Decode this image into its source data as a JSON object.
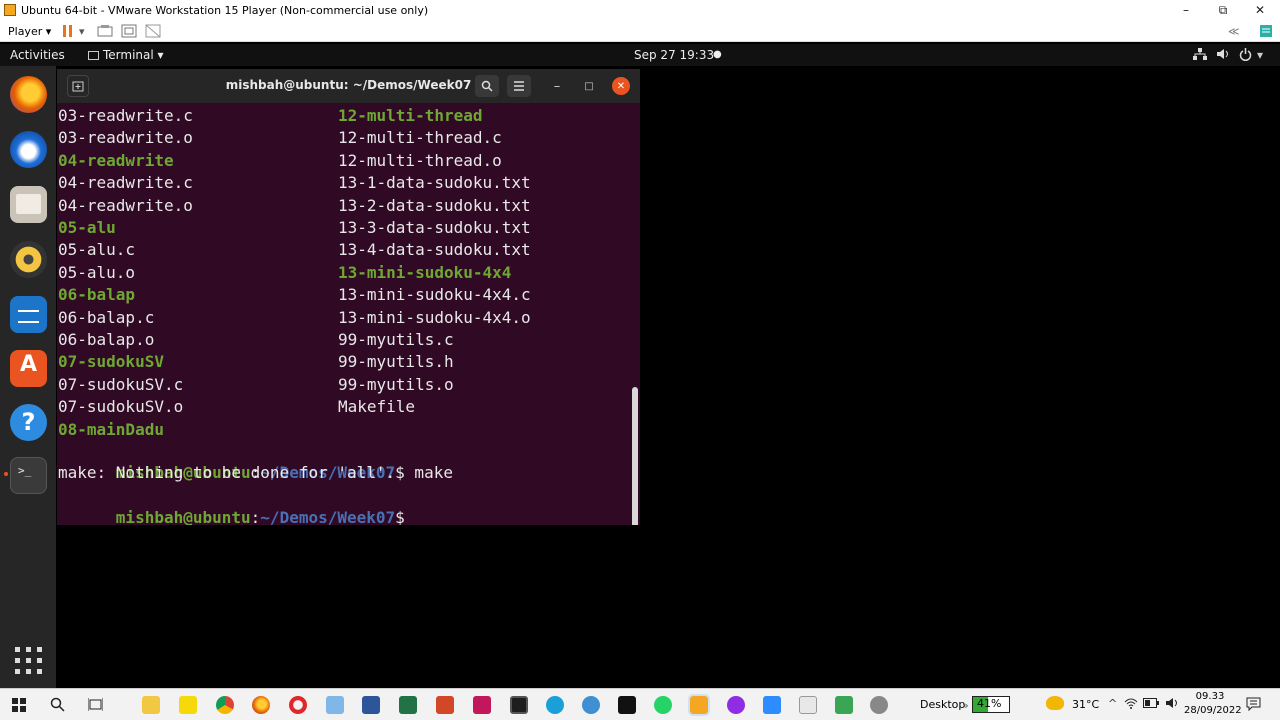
{
  "vmware": {
    "title": "Ubuntu 64-bit - VMware Workstation 15 Player (Non-commercial use only)",
    "player_label": "Player ▾",
    "min": "–",
    "max": "⧉",
    "close": "✕"
  },
  "ubuntu": {
    "activities": "Activities",
    "app_menu": "Terminal ▾",
    "clock": "Sep 27  19:33",
    "status_dot": "●"
  },
  "terminal": {
    "title": "mishbah@ubuntu: ~/Demos/Week07",
    "colors": {
      "bg": "#300a24",
      "green": "#6ea832",
      "blue": "#4a6fb5"
    },
    "lines": [
      {
        "left": "03-readwrite.c",
        "left_dir": false,
        "right": "12-multi-thread",
        "right_dir": true
      },
      {
        "left": "03-readwrite.o",
        "left_dir": false,
        "right": "12-multi-thread.c",
        "right_dir": false
      },
      {
        "left": "04-readwrite",
        "left_dir": true,
        "right": "12-multi-thread.o",
        "right_dir": false
      },
      {
        "left": "04-readwrite.c",
        "left_dir": false,
        "right": "13-1-data-sudoku.txt",
        "right_dir": false
      },
      {
        "left": "04-readwrite.o",
        "left_dir": false,
        "right": "13-2-data-sudoku.txt",
        "right_dir": false
      },
      {
        "left": "05-alu",
        "left_dir": true,
        "right": "13-3-data-sudoku.txt",
        "right_dir": false
      },
      {
        "left": "05-alu.c",
        "left_dir": false,
        "right": "13-4-data-sudoku.txt",
        "right_dir": false
      },
      {
        "left": "05-alu.o",
        "left_dir": false,
        "right": "13-mini-sudoku-4x4",
        "right_dir": true
      },
      {
        "left": "06-balap",
        "left_dir": true,
        "right": "13-mini-sudoku-4x4.c",
        "right_dir": false
      },
      {
        "left": "06-balap.c",
        "left_dir": false,
        "right": "13-mini-sudoku-4x4.o",
        "right_dir": false
      },
      {
        "left": "06-balap.o",
        "left_dir": false,
        "right": "99-myutils.c",
        "right_dir": false
      },
      {
        "left": "07-sudokuSV",
        "left_dir": true,
        "right": "99-myutils.h",
        "right_dir": false
      },
      {
        "left": "07-sudokuSV.c",
        "left_dir": false,
        "right": "99-myutils.o",
        "right_dir": false
      },
      {
        "left": "07-sudokuSV.o",
        "left_dir": false,
        "right": "Makefile",
        "right_dir": false
      },
      {
        "left": "08-mainDadu",
        "left_dir": true,
        "right": "",
        "right_dir": false
      }
    ],
    "prompt_user": "mishbah@ubuntu",
    "prompt_sep": ":",
    "prompt_path": "~/Demos/Week07",
    "prompt_dollar": "$",
    "cmd1": " make",
    "output1": "make: Nothing to be done for 'all'."
  },
  "taskbar": {
    "desktop_label": "Desktop",
    "battery": "41%",
    "temperature": "31°C",
    "time": "09.33",
    "date": "28/09/2022"
  }
}
